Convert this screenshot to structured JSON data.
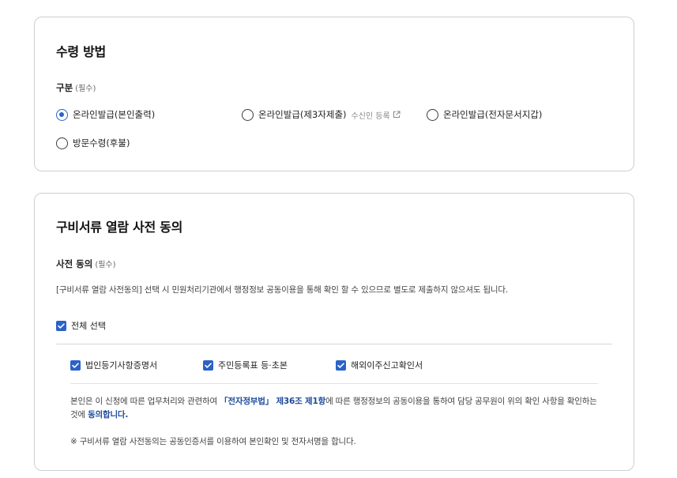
{
  "receipt": {
    "title": "수령 방법",
    "label": "구분",
    "required": "(필수)",
    "options": [
      {
        "label": "온라인발급(본인출력)",
        "checked": true
      },
      {
        "label": "온라인발급(제3자제출)",
        "checked": false,
        "sub": "수신인 등록"
      },
      {
        "label": "온라인발급(전자문서지갑)",
        "checked": false
      },
      {
        "label": "방문수령(후불)",
        "checked": false
      }
    ]
  },
  "consent": {
    "title": "구비서류 열람 사전 동의",
    "label": "사전 동의",
    "required": "(필수)",
    "description": "[구비서류 열람 사전동의] 선택 시 민원처리기관에서 행정정보 공동이용을 통해 확인 할 수 있으므로 별도로 제출하지 않으셔도 됩니다.",
    "select_all": "전체 선택",
    "items": [
      "법인등기사항증명서",
      "주민등록표 등·초본",
      "해외이주신고확인서"
    ],
    "notice_pre": "본인은 이 신청에 따른 업무처리와 관련하여 ",
    "notice_law": "「전자정부법」 제36조 제1항",
    "notice_mid": "에 따른 행정정보의 공동이용을 통하여 담당 공무원이 위의 확인 사항을 확인하는 것에 ",
    "notice_agree": "동의합니다.",
    "note": "※ 구비서류 열람 사전동의는 공동인증서를 이용하여 본인확인 및 전자서명을 합니다."
  },
  "colors": {
    "accent": "#2a62c9",
    "link": "#1d4a9b",
    "border": "#cfcfd4"
  },
  "icons": {
    "external_link": "external-link-icon",
    "check": "check-icon"
  }
}
